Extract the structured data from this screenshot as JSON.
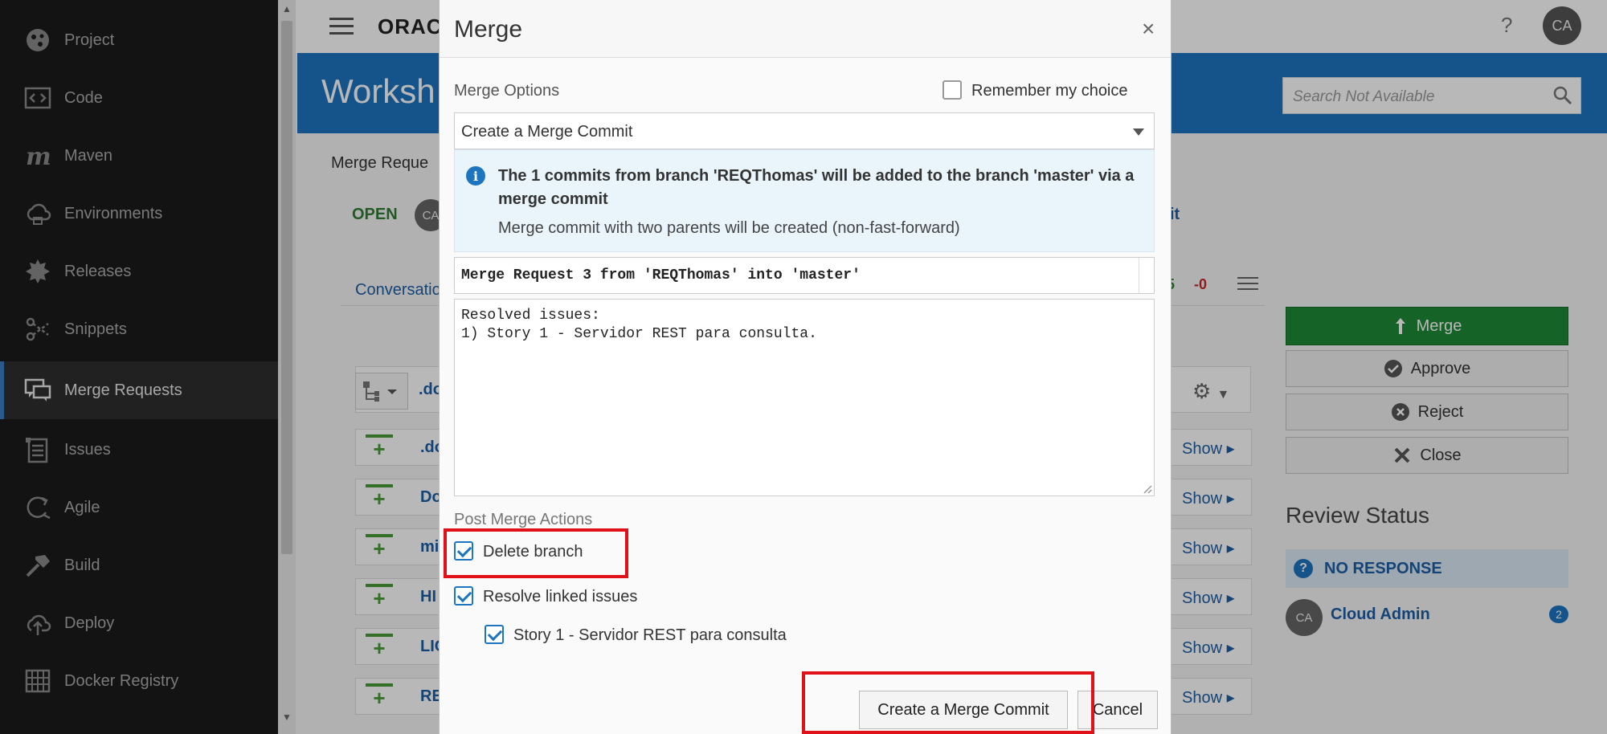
{
  "sidebar": {
    "items": [
      {
        "label": "Project",
        "icon": "project-icon"
      },
      {
        "label": "Code",
        "icon": "code-icon"
      },
      {
        "label": "Maven",
        "icon": "maven-icon"
      },
      {
        "label": "Environments",
        "icon": "environments-icon"
      },
      {
        "label": "Releases",
        "icon": "releases-icon"
      },
      {
        "label": "Snippets",
        "icon": "snippets-icon"
      },
      {
        "label": "Merge Requests",
        "icon": "merge-requests-icon",
        "active": true
      },
      {
        "label": "Issues",
        "icon": "issues-icon"
      },
      {
        "label": "Agile",
        "icon": "agile-icon"
      },
      {
        "label": "Build",
        "icon": "build-icon"
      },
      {
        "label": "Deploy",
        "icon": "deploy-icon"
      },
      {
        "label": "Docker Registry",
        "icon": "docker-registry-icon"
      }
    ]
  },
  "topbar": {
    "logo": "ORAC",
    "help": "?",
    "avatar": "CA"
  },
  "header": {
    "title": "Worksh",
    "search_placeholder": "Search Not Available"
  },
  "page": {
    "breadcrumb": "Merge Reque",
    "status": "OPEN",
    "author_avatar": "CA",
    "edit_fragment": "it",
    "tab_label": "Conversatio",
    "diff_plus": "5",
    "diff_minus": "-0",
    "file_rows": [
      {
        "name": ".do"
      },
      {
        "name": ".do",
        "show": "Show"
      },
      {
        "name": "Do",
        "show": "Show"
      },
      {
        "name": "mi",
        "show": "Show"
      },
      {
        "name": "HI",
        "show": "Show"
      },
      {
        "name": "LIC",
        "show": "Show"
      },
      {
        "name": "RE",
        "show": "Show"
      }
    ]
  },
  "actions": {
    "merge": "Merge",
    "approve": "Approve",
    "reject": "Reject",
    "close": "Close"
  },
  "review": {
    "title": "Review Status",
    "status": "NO RESPONSE",
    "reviewer_avatar": "CA",
    "reviewer_name": "Cloud Admin",
    "count": "2"
  },
  "modal": {
    "title": "Merge",
    "close": "×",
    "options_label": "Merge Options",
    "remember_label": "Remember my choice",
    "remember_checked": false,
    "strategy_value": "Create a Merge Commit",
    "info_main": "The 1 commits from branch 'REQThomas' will be added to the branch 'master' via a merge commit",
    "info_sub": "Merge commit with two parents will be created (non-fast-forward)",
    "commit_title": "Merge Request 3 from 'REQThomas' into 'master'",
    "commit_body_line1": "Resolved issues:",
    "commit_body_line2": "1) Story 1 - Servidor REST para consulta.",
    "post_actions_label": "Post Merge Actions",
    "delete_branch_label": "Delete branch",
    "delete_branch_checked": true,
    "resolve_issues_label": "Resolve linked issues",
    "resolve_issues_checked": true,
    "story_label": "Story 1 - Servidor REST para consulta",
    "story_checked": true,
    "submit_label": "Create a Merge Commit",
    "cancel_label": "Cancel"
  },
  "colors": {
    "sidebar_bg": "#1b1b1b",
    "header_blue": "#1d75c0",
    "merge_green": "#1e8a35",
    "highlight_red": "#e1111a"
  }
}
